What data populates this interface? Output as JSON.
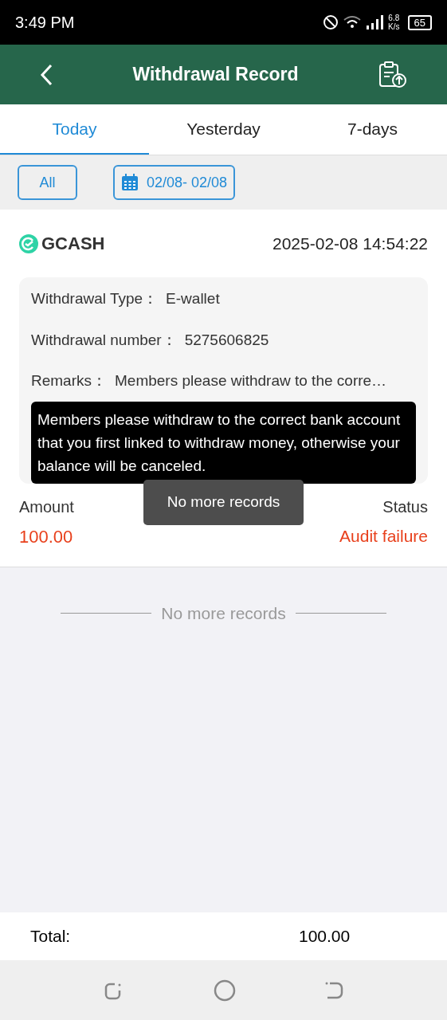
{
  "status_bar": {
    "time": "3:49 PM",
    "net_speed_value": "6.8",
    "net_speed_unit": "K/s",
    "battery": "65"
  },
  "header": {
    "title": "Withdrawal Record"
  },
  "tabs": [
    {
      "label": "Today",
      "selected": true
    },
    {
      "label": "Yesterday",
      "selected": false
    },
    {
      "label": "7-days",
      "selected": false
    }
  ],
  "filters": {
    "all_label": "All",
    "date_range": "02/08- 02/08"
  },
  "record": {
    "provider": "GCASH",
    "datetime": "2025-02-08 14:54:22",
    "details": [
      {
        "label": "Withdrawal Type：",
        "value": "E-wallet"
      },
      {
        "label": "Withdrawal number：",
        "value": "5275606825"
      },
      {
        "label": "Remarks：",
        "value": "Members please withdraw to the corre…"
      }
    ],
    "tooltip": "Members please withdraw to the correct bank account that you first linked to withdraw money, otherwise your balance will be canceled.",
    "amount_label": "Amount",
    "amount": "100.00",
    "status_label": "Status",
    "status": "Audit failure"
  },
  "toast": "No more records",
  "end_note": "No more records",
  "footer": {
    "total_label": "Total:",
    "total": "100.00"
  }
}
